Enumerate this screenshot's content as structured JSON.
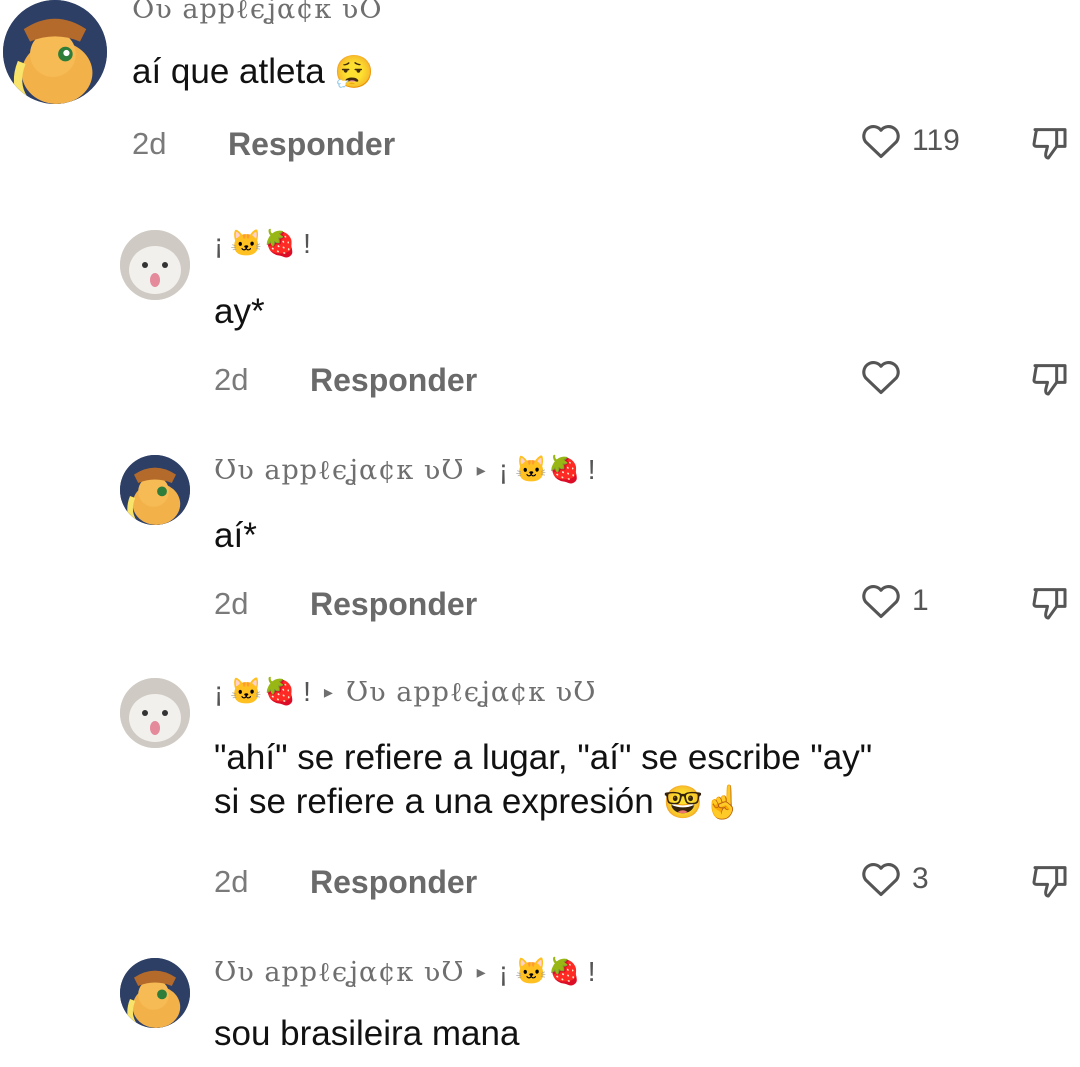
{
  "comments": [
    {
      "username": "Ʊʋ appℓєʝα¢к ʋƱ",
      "reply_to": "",
      "text_line1": "aí que atleta",
      "text_emoji": "😮‍💨",
      "time": "2d",
      "reply_label": "Responder",
      "likes": "119",
      "avatar_icon": "applejack-pony-avatar"
    },
    {
      "username_prefix": "¡",
      "username_emoji": "🐱🍓",
      "username_suffix": "!",
      "text_line1": "ay*",
      "time": "2d",
      "reply_label": "Responder",
      "likes": "",
      "avatar_icon": "cat-avatar"
    },
    {
      "username": "Ʊʋ appℓєʝα¢к ʋƱ",
      "arrow": "▸",
      "reply_prefix": "¡",
      "reply_emoji": "🐱🍓",
      "reply_suffix": "!",
      "text_line1": "aí*",
      "time": "2d",
      "reply_label": "Responder",
      "likes": "1",
      "avatar_icon": "applejack-pony-avatar"
    },
    {
      "username_prefix": "¡",
      "username_emoji": "🐱🍓",
      "username_suffix": "!",
      "arrow": "▸",
      "reply_to": "Ʊʋ appℓєʝα¢к ʋƱ",
      "text_line1": "\"ahí\" se refiere a lugar, \"aí\" se escribe \"ay\"",
      "text_line2": "si se refiere a una expresión",
      "text_emoji": "🤓☝️",
      "time": "2d",
      "reply_label": "Responder",
      "likes": "3",
      "avatar_icon": "cat-avatar"
    },
    {
      "username": "Ʊʋ appℓєʝα¢к ʋƱ",
      "arrow": "▸",
      "reply_prefix": "¡",
      "reply_emoji": "🐱🍓",
      "reply_suffix": "!",
      "text_line1": "sou brasileira mana",
      "avatar_icon": "applejack-pony-avatar"
    }
  ],
  "colors": {
    "text": "#111111",
    "meta": "#7a7a7a",
    "username": "#6f6f6f",
    "background": "#ffffff"
  },
  "icons": {
    "like": "heart-outline-icon",
    "dislike": "thumbs-down-icon",
    "reply_arrow": "triangle-right-icon"
  }
}
